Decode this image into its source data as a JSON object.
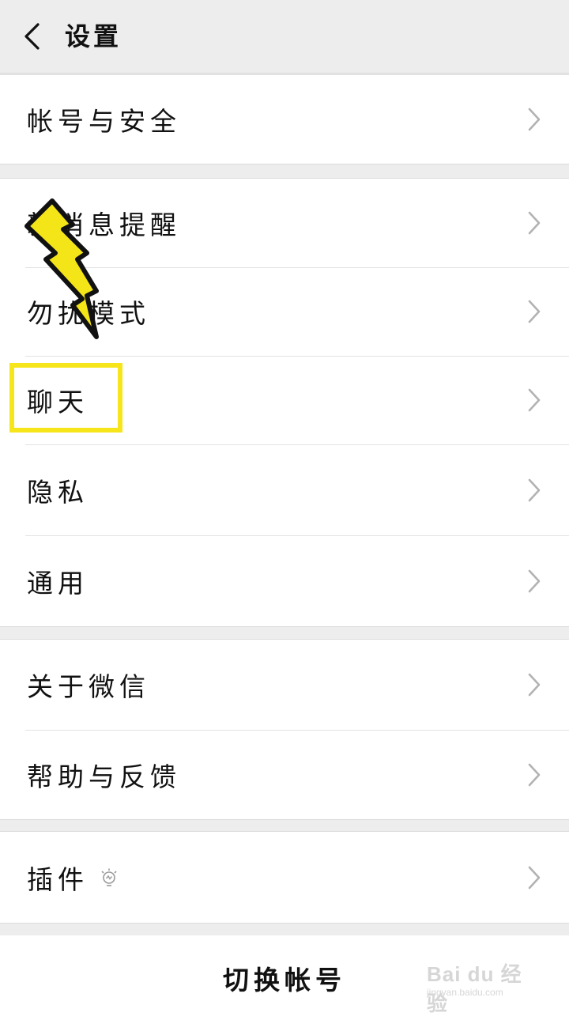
{
  "header": {
    "back_icon": "chevron-left-icon",
    "title": "设置"
  },
  "groups": [
    {
      "items": [
        {
          "label": "帐号与安全"
        }
      ]
    },
    {
      "items": [
        {
          "label": "新消息提醒"
        },
        {
          "label": "勿扰模式"
        },
        {
          "label": "聊天"
        },
        {
          "label": "隐私"
        },
        {
          "label": "通用"
        }
      ]
    },
    {
      "items": [
        {
          "label": "关于微信"
        },
        {
          "label": "帮助与反馈"
        }
      ]
    },
    {
      "items": [
        {
          "label": "插件",
          "badge_icon": "bulb-icon"
        }
      ]
    }
  ],
  "footer": {
    "switch_account": "切换帐号"
  },
  "annotation": {
    "highlight_color": "#f5e51a",
    "arrow_icon": "lightning-arrow-icon"
  },
  "watermark": {
    "brand": "Bai du 经验",
    "url": "jingyan.baidu.com"
  }
}
